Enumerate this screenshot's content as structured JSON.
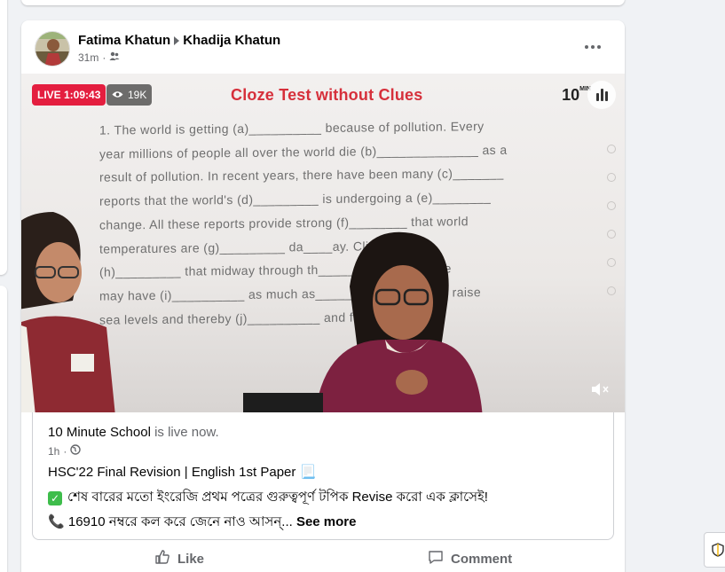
{
  "post": {
    "author": "Fatima Khatun",
    "shared_to": "Khadija Khatun",
    "time": "31m",
    "privacy_icon": "friends-icon",
    "more_icon": "more-dots-icon"
  },
  "video": {
    "live_label": "LIVE 1:09:43",
    "views": "19K",
    "logo_text": "10 MIN SCH",
    "board_title": "Cloze Test without Clues",
    "board_lines": [
      "1. The world is getting (a)__________ because of pollution. Every",
      "year millions of people all over the world die (b)______________ as a",
      "result of pollution. In recent years, there have been many (c)_______",
      "reports that the world's (d)_________ is undergoing a (e)________",
      "change. All these reports provide strong (f)________ that world",
      "temperatures are (g)_________ da____ay. Climatologists",
      "(h)_________ that midway through th_____tury temperature",
      "may have (i)__________ as much as_________. This could raise",
      "sea levels and thereby (j)__________ and farmlands."
    ]
  },
  "shared": {
    "page_name": "10 Minute School",
    "status": "is live now.",
    "time": "1h",
    "title": "HSC'22 Final Revision | English 1st Paper 📃",
    "bengali_line": "শেষ বারের মতো ইংরেজি প্রথম পত্রের গুরুত্বপূর্ণ টপিক Revise করো এক ক্লাসেই!",
    "phone_line": "16910 নম্বরে কল করে জেনে নাও আসন্...",
    "see_more": "See more"
  },
  "actions": {
    "like": "Like",
    "comment": "Comment"
  },
  "colors": {
    "live": "#e41e3f",
    "board_title": "#d6303b",
    "text_secondary": "#65676b"
  }
}
